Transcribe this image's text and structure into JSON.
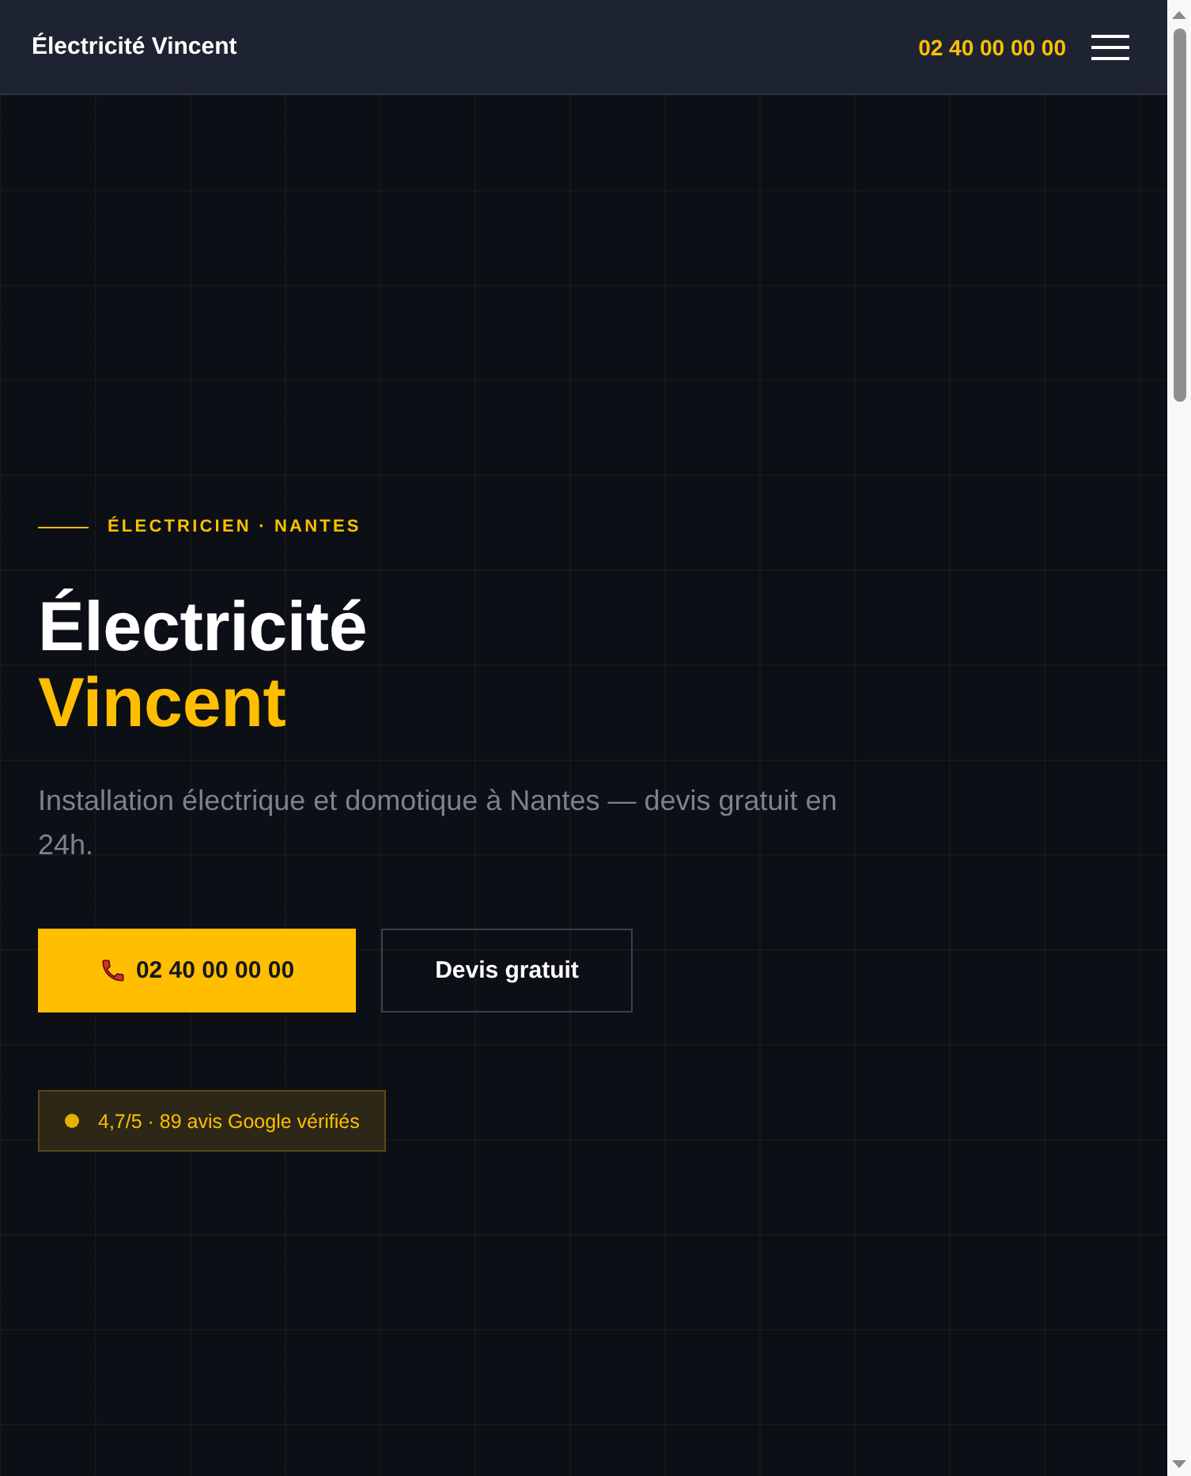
{
  "header": {
    "brand": "Électricité Vincent",
    "phone": "02 40 00 00 00"
  },
  "hero": {
    "eyebrow": "ÉLECTRICIEN · NANTES",
    "title": "Électricité",
    "title_highlight": "Vincent",
    "description": "Installation électrique et domotique à Nantes — devis gratuit en 24h.",
    "buttons": [
      {
        "kind": "primary",
        "label": "02 40 00 00 00"
      },
      {
        "kind": "secondary",
        "label": "Devis gratuit"
      }
    ],
    "rating_badge": "4,7/5 · 89 avis Google vérifiés"
  }
}
